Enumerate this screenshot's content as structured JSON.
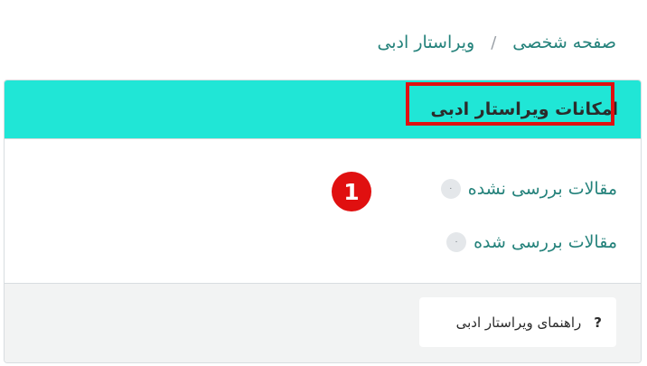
{
  "breadcrumb": {
    "home": "صفحه شخصی",
    "separator": "/",
    "current": "ویراستار ادبی"
  },
  "panel": {
    "title": "امکانات ویراستار ادبی",
    "items": [
      {
        "label": "مقالات بررسی نشده",
        "count": "۰"
      },
      {
        "label": "مقالات بررسی شده",
        "count": "۰"
      }
    ],
    "help": {
      "icon": "?",
      "label": "راهنمای ویراستار ادبی"
    }
  },
  "annotation": {
    "step": "1"
  },
  "colors": {
    "header_bg": "#20e6d6",
    "link": "#24827b",
    "highlight": "#e01010"
  }
}
